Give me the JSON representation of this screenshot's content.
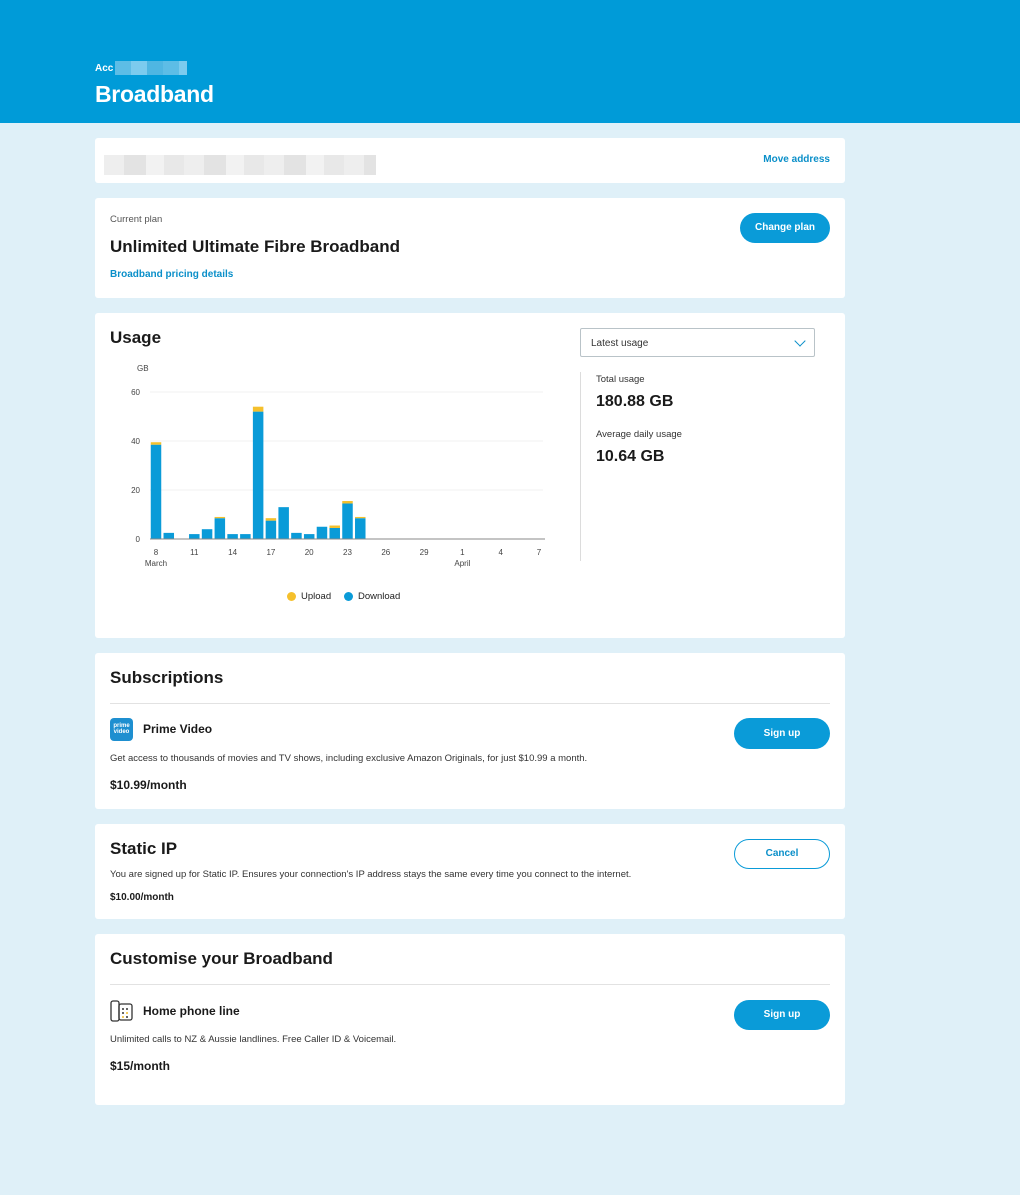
{
  "header": {
    "account_label": "Acc",
    "title": "Broadband"
  },
  "address": {
    "move_label": "Move address"
  },
  "plan": {
    "current_label": "Current plan",
    "name": "Unlimited Ultimate Fibre Broadband",
    "pricing_link": "Broadband pricing details",
    "change_label": "Change plan"
  },
  "usage": {
    "title": "Usage",
    "dropdown_value": "Latest usage",
    "total_label": "Total usage",
    "total_value": "180.88 GB",
    "avg_label": "Average daily usage",
    "avg_value": "10.64 GB",
    "legend_upload": "Upload",
    "legend_download": "Download"
  },
  "chart_data": {
    "type": "bar",
    "stacked": true,
    "ylabel": "GB",
    "ylim": [
      0,
      60
    ],
    "yticks": [
      0,
      20,
      40,
      60
    ],
    "x_tick_labels": [
      {
        "day": 8,
        "label": "8",
        "sub": "March"
      },
      {
        "day": 11,
        "label": "11",
        "sub": ""
      },
      {
        "day": 14,
        "label": "14",
        "sub": ""
      },
      {
        "day": 17,
        "label": "17",
        "sub": ""
      },
      {
        "day": 20,
        "label": "20",
        "sub": ""
      },
      {
        "day": 23,
        "label": "23",
        "sub": ""
      },
      {
        "day": 26,
        "label": "26",
        "sub": ""
      },
      {
        "day": 29,
        "label": "29",
        "sub": ""
      },
      {
        "day": 32,
        "label": "1",
        "sub": "April"
      },
      {
        "day": 35,
        "label": "4",
        "sub": ""
      },
      {
        "day": 38,
        "label": "7",
        "sub": ""
      }
    ],
    "days": [
      8,
      9,
      10,
      11,
      12,
      13,
      14,
      15,
      16,
      17,
      18,
      19,
      20,
      21,
      22,
      23,
      24
    ],
    "series": [
      {
        "name": "Download",
        "color": "#0a9bd8",
        "values": [
          38.5,
          2.5,
          0,
          2,
          4,
          8.5,
          2,
          2,
          52,
          7.5,
          13,
          2.5,
          2,
          5,
          4.5,
          14.5,
          8.5
        ]
      },
      {
        "name": "Upload",
        "color": "#f5c02c",
        "values": [
          1,
          0,
          0,
          0,
          0,
          0.5,
          0,
          0,
          2,
          1,
          0,
          0,
          0,
          0,
          1,
          1,
          0.5
        ]
      }
    ]
  },
  "subscriptions": {
    "title": "Subscriptions",
    "item_icon": "prime-video-logo",
    "item_icon_text": "prime video",
    "item_name": "Prime Video",
    "item_desc": "Get access to thousands of movies and TV shows, including exclusive Amazon Originals, for just $10.99 a month.",
    "item_price": "$10.99/month",
    "signup_label": "Sign up"
  },
  "static_ip": {
    "title": "Static IP",
    "desc": "You are signed up for Static IP. Ensures your connection's IP address stays the same every time you connect to the internet.",
    "price": "$10.00/month",
    "cancel_label": "Cancel"
  },
  "customise": {
    "title": "Customise your Broadband",
    "item_icon": "phone-icon",
    "item_name": "Home phone line",
    "item_desc": "Unlimited calls to NZ & Aussie landlines. Free Caller ID & Voicemail.",
    "item_price": "$15/month",
    "signup_label": "Sign up"
  }
}
